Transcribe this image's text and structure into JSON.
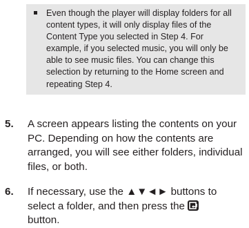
{
  "note": {
    "text": "Even though the player will display folders for all content types, it will only display files of the Content Type you selected in Step 4. For example, if you selected music, you will only be able to see music files. You can change this selection by returning to the Home screen and repeating Step 4."
  },
  "steps": [
    {
      "number": "5.",
      "text": "A screen appears listing the contents on your PC. Depending on how the contents are arranged, you will see either folders, individual files, or both."
    },
    {
      "number": "6.",
      "text_before": "If necessary, use the ▲▼◄► buttons to select a folder, and then press the",
      "icon": "enter-icon",
      "text_after": "button."
    }
  ]
}
